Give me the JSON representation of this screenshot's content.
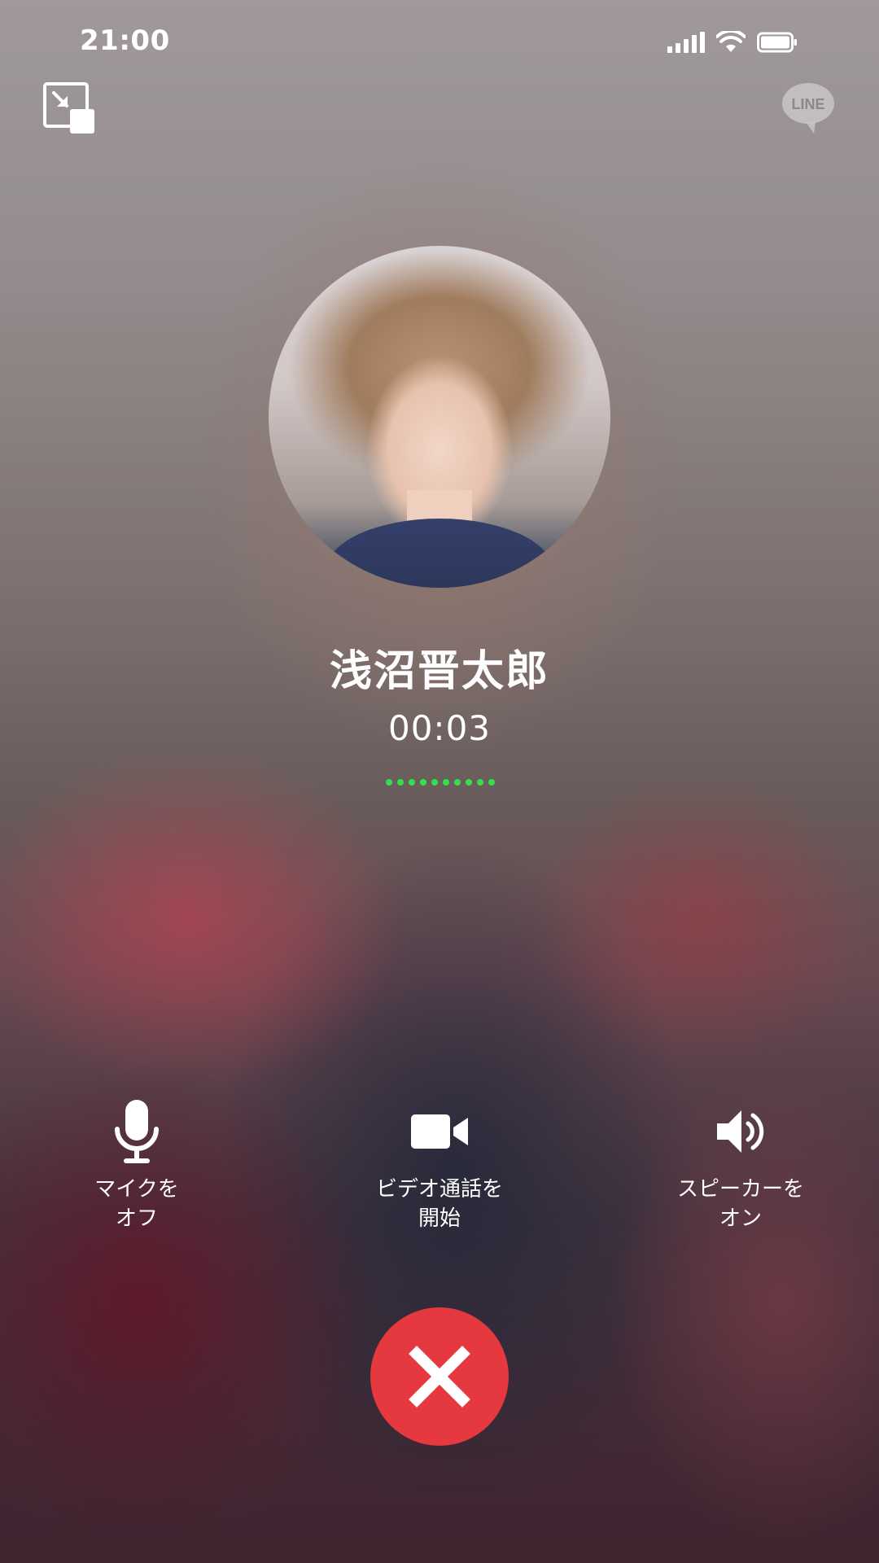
{
  "status_bar": {
    "time": "21:00",
    "icons": [
      "cellular-signal-icon",
      "wifi-icon",
      "battery-icon"
    ]
  },
  "top_controls": {
    "minimize_icon": "minimize-pip-icon",
    "logo_text": "LINE"
  },
  "call": {
    "caller_name": "浅沼晋太郎",
    "duration": "00:03",
    "indicator_color": "#35e04d"
  },
  "actions": {
    "mic": {
      "label": "マイクを\nオフ",
      "icon": "microphone-icon"
    },
    "video": {
      "label": "ビデオ通話を\n開始",
      "icon": "video-camera-icon"
    },
    "speaker": {
      "label": "スピーカーを\nオン",
      "icon": "speaker-icon"
    }
  },
  "end_call": {
    "icon": "close-x-icon",
    "color": "#e6393f"
  }
}
